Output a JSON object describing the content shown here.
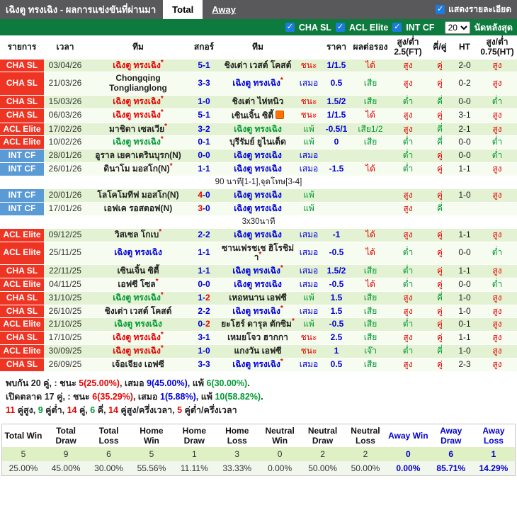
{
  "colors": {
    "red": "#e60000",
    "green": "#009933",
    "blue": "#0000dd",
    "black": "#222",
    "league_red": "#ee3524",
    "league_blue": "#5b9bd5",
    "bar_green": "#0d7a3e",
    "titlebar_gray": "#59595b"
  },
  "titlebar": {
    "title": "เฉิงตู ทรงเฉิง - ผลการแข่งขันที่ผ่านมา",
    "tabs": [
      {
        "label": "Total",
        "active": true
      },
      {
        "label": "Away",
        "active": false
      }
    ],
    "details_checkbox_label": "แสดงรายละเอียด",
    "details_checked": true
  },
  "filterbar": {
    "leagues": [
      "CHA SL",
      "ACL Elite",
      "INT CF"
    ],
    "select_value": "20",
    "last_matches_label": "นัดหลังสุด"
  },
  "table": {
    "columns": [
      "รายการ",
      "เวลา",
      "ทีม",
      "สกอร์",
      "ทีม",
      "",
      "ราคา",
      "ผลต่อรอง",
      "สูง/ต่ำ 2.5(FT)",
      "คี่/คู่",
      "HT",
      "สูง/ต่ำ 0.75(HT)"
    ],
    "rows": [
      {
        "lg": "CHA SL",
        "lgc": "red",
        "d": "03/04/26",
        "t1": "เฉิงตู ทรงเฉิง",
        "t1c": "red",
        "t1star": true,
        "s1": "5",
        "s2": "1",
        "t2": "ชิงเต่า เวสต์ โคสต์",
        "res": "ชนะ",
        "resc": "red",
        "odds": "1/1.5",
        "hcp": "ได้",
        "hcpc": "red",
        "ou": "สูง",
        "ouc": "red",
        "oe": "คู่",
        "oec": "red",
        "ht": "2-0",
        "ouht": "สูง",
        "ouhtc": "red"
      },
      {
        "lg": "CHA SL",
        "lgc": "red",
        "d": "21/03/26",
        "t1": "Chongqing Tonglianglong",
        "s1": "3",
        "s2": "3",
        "t2": "เฉิงตู ทรงเฉิง",
        "t2c": "blue",
        "t2star": true,
        "res": "เสมอ",
        "resc": "blue",
        "odds": "0.5",
        "hcp": "เสีย",
        "hcpc": "green",
        "ou": "สูง",
        "ouc": "red",
        "oe": "คู่",
        "oec": "red",
        "ht": "0-2",
        "ouht": "สูง",
        "ouhtc": "red"
      },
      {
        "lg": "CHA SL",
        "lgc": "red",
        "d": "15/03/26",
        "t1": "เฉิงตู ทรงเฉิง",
        "t1c": "red",
        "t1star": true,
        "s1": "1",
        "s2": "0",
        "t2": "ชิงเต่า ไห่หนิว",
        "res": "ชนะ",
        "resc": "red",
        "odds": "1.5/2",
        "hcp": "เสีย",
        "hcpc": "green",
        "ou": "ต่ำ",
        "ouc": "green",
        "oe": "คี่",
        "oec": "green",
        "ht": "0-0",
        "ouht": "ต่ำ",
        "ouhtc": "green"
      },
      {
        "lg": "CHA SL",
        "lgc": "red",
        "d": "06/03/26",
        "t1": "เฉิงตู ทรงเฉิง",
        "t1c": "red",
        "t1star": true,
        "s1": "5",
        "s2": "1",
        "t2": "เซินเจิ้น ซิตี้",
        "t2badge": true,
        "res": "ชนะ",
        "resc": "red",
        "odds": "1/1.5",
        "hcp": "ได้",
        "hcpc": "red",
        "ou": "สูง",
        "ouc": "red",
        "oe": "คู่",
        "oec": "red",
        "ht": "3-1",
        "ouht": "สูง",
        "ouhtc": "red"
      },
      {
        "lg": "ACL Elite",
        "lgc": "red",
        "d": "17/02/26",
        "t1": "มาชิดา เซลเวีย",
        "t1star": true,
        "s1": "3",
        "s2": "2",
        "t2": "เฉิงตู ทรงเฉิง",
        "t2c": "green",
        "res": "แพ้",
        "resc": "green",
        "odds": "-0.5/1",
        "hcp": "เสีย1/2",
        "hcpc": "green",
        "ou": "สูง",
        "ouc": "red",
        "oe": "คี่",
        "oec": "green",
        "ht": "2-1",
        "ouht": "สูง",
        "ouhtc": "red"
      },
      {
        "lg": "ACL Elite",
        "lgc": "red",
        "d": "10/02/26",
        "t1": "เฉิงตู ทรงเฉิง",
        "t1c": "green",
        "t1star": true,
        "s1": "0",
        "s2": "1",
        "t2": "บุรีรัมย์ ยูไนเต็ด",
        "res": "แพ้",
        "resc": "green",
        "odds": "0",
        "hcp": "เสีย",
        "hcpc": "green",
        "ou": "ต่ำ",
        "ouc": "green",
        "oe": "คี่",
        "oec": "green",
        "ht": "0-0",
        "ouht": "ต่ำ",
        "ouhtc": "green"
      },
      {
        "lg": "INT CF",
        "lgc": "blue",
        "d": "28/01/26",
        "t1": "อูราล เยคาเตรินบุรก(N)",
        "s1": "0",
        "s2": "0",
        "t2": "เฉิงตู ทรงเฉิง",
        "t2c": "blue",
        "res": "เสมอ",
        "resc": "blue",
        "odds": "",
        "hcp": "",
        "ou": "ต่ำ",
        "ouc": "green",
        "oe": "คู่",
        "oec": "red",
        "ht": "0-0",
        "ouht": "ต่ำ",
        "ouhtc": "green"
      },
      {
        "lg": "INT CF",
        "lgc": "blue",
        "d": "26/01/26",
        "t1": "ดินาโม มอสโก(N)",
        "t1star": true,
        "s1": "1",
        "s2": "1",
        "t2": "เฉิงตู ทรงเฉิง",
        "t2c": "blue",
        "res": "เสมอ",
        "resc": "blue",
        "odds": "-1.5",
        "hcp": "ได้",
        "hcpc": "red",
        "ou": "ต่ำ",
        "ouc": "green",
        "oe": "คู่",
        "oec": "red",
        "ht": "1-1",
        "ouht": "สูง",
        "ouhtc": "red"
      },
      {
        "note": "90 นาที[1-1],จุดโทษ[3-4]"
      },
      {
        "lg": "INT CF",
        "lgc": "blue",
        "d": "20/01/26",
        "t1": "โลโคโมทีฟ มอสโก(N)",
        "s1": "4",
        "s1c": "red",
        "s2": "0",
        "t2": "เฉิงตู ทรงเฉิง",
        "t2c": "blue",
        "res": "แพ้",
        "resc": "green",
        "odds": "",
        "hcp": "",
        "ou": "สูง",
        "ouc": "red",
        "oe": "คู่",
        "oec": "red",
        "ht": "1-0",
        "ouht": "สูง",
        "ouhtc": "red"
      },
      {
        "lg": "INT CF",
        "lgc": "blue",
        "d": "17/01/26",
        "t1": "เอฟเค รอสตอฟ(N)",
        "s1": "3",
        "s1c": "red",
        "s2": "0",
        "t2": "เฉิงตู ทรงเฉิง",
        "t2c": "blue",
        "res": "แพ้",
        "resc": "green",
        "odds": "",
        "hcp": "",
        "ou": "สูง",
        "ouc": "red",
        "oe": "คี่",
        "oec": "green",
        "ht": "",
        "ouht": ""
      },
      {
        "note": "3x30นาที"
      },
      {
        "lg": "ACL Elite",
        "lgc": "red",
        "d": "09/12/25",
        "t1": "วิสเซล โกเบ",
        "t1star": true,
        "s1": "2",
        "s2": "2",
        "t2": "เฉิงตู ทรงเฉิง",
        "t2c": "blue",
        "res": "เสมอ",
        "resc": "blue",
        "odds": "-1",
        "hcp": "ได้",
        "hcpc": "red",
        "ou": "สูง",
        "ouc": "red",
        "oe": "คู่",
        "oec": "red",
        "ht": "1-1",
        "ouht": "สูง",
        "ouhtc": "red"
      },
      {
        "lg": "ACL Elite",
        "lgc": "red",
        "d": "25/11/25",
        "t1": "เฉิงตู ทรงเฉิง",
        "t1c": "blue",
        "s1": "1",
        "s2": "1",
        "t2": "ซานเฟรชเช ฮิโรชิม่า",
        "t2star": true,
        "res": "เสมอ",
        "resc": "blue",
        "odds": "-0.5",
        "hcp": "ได้",
        "hcpc": "red",
        "ou": "ต่ำ",
        "ouc": "green",
        "oe": "คู่",
        "oec": "red",
        "ht": "0-0",
        "ouht": "ต่ำ",
        "ouhtc": "green"
      },
      {
        "lg": "CHA SL",
        "lgc": "red",
        "d": "22/11/25",
        "t1": "เซินเจิ้น ซิตี้",
        "s1": "1",
        "s2": "1",
        "t2": "เฉิงตู ทรงเฉิง",
        "t2c": "blue",
        "t2star": true,
        "res": "เสมอ",
        "resc": "blue",
        "odds": "1.5/2",
        "hcp": "เสีย",
        "hcpc": "green",
        "ou": "ต่ำ",
        "ouc": "green",
        "oe": "คู่",
        "oec": "red",
        "ht": "1-1",
        "ouht": "สูง",
        "ouhtc": "red"
      },
      {
        "lg": "ACL Elite",
        "lgc": "red",
        "d": "04/11/25",
        "t1": "เอฟซี โซล",
        "t1star": true,
        "s1": "0",
        "s2": "0",
        "t2": "เฉิงตู ทรงเฉิง",
        "t2c": "blue",
        "res": "เสมอ",
        "resc": "blue",
        "odds": "-0.5",
        "hcp": "ได้",
        "hcpc": "red",
        "ou": "ต่ำ",
        "ouc": "green",
        "oe": "คู่",
        "oec": "red",
        "ht": "0-0",
        "ouht": "ต่ำ",
        "ouhtc": "green"
      },
      {
        "lg": "CHA SL",
        "lgc": "red",
        "d": "31/10/25",
        "t1": "เฉิงตู ทรงเฉิง",
        "t1c": "green",
        "t1star": true,
        "s1": "1",
        "s2": "2",
        "s2c": "red",
        "t2": "เหอหนาน เอฟซี",
        "res": "แพ้",
        "resc": "green",
        "odds": "1.5",
        "hcp": "เสีย",
        "hcpc": "green",
        "ou": "สูง",
        "ouc": "red",
        "oe": "คี่",
        "oec": "green",
        "ht": "1-0",
        "ouht": "สูง",
        "ouhtc": "red"
      },
      {
        "lg": "CHA SL",
        "lgc": "red",
        "d": "26/10/25",
        "t1": "ชิงเต่า เวสต์ โคสต์",
        "s1": "2",
        "s2": "2",
        "t2": "เฉิงตู ทรงเฉิง",
        "t2c": "blue",
        "t2star": true,
        "res": "เสมอ",
        "resc": "blue",
        "odds": "1.5",
        "hcp": "เสีย",
        "hcpc": "green",
        "ou": "สูง",
        "ouc": "red",
        "oe": "คู่",
        "oec": "red",
        "ht": "1-0",
        "ouht": "สูง",
        "ouhtc": "red"
      },
      {
        "lg": "ACL Elite",
        "lgc": "red",
        "d": "21/10/25",
        "t1": "เฉิงตู ทรงเฉิง",
        "t1c": "green",
        "s1": "0",
        "s2": "2",
        "s2c": "red",
        "t2": "ยะโฮร์ ดารุล ตักซิม",
        "t2star": true,
        "res": "แพ้",
        "resc": "green",
        "odds": "-0.5",
        "hcp": "เสีย",
        "hcpc": "green",
        "ou": "ต่ำ",
        "ouc": "green",
        "oe": "คู่",
        "oec": "red",
        "ht": "0-1",
        "ouht": "สูง",
        "ouhtc": "red"
      },
      {
        "lg": "CHA SL",
        "lgc": "red",
        "d": "17/10/25",
        "t1": "เฉิงตู ทรงเฉิง",
        "t1c": "red",
        "t1star": true,
        "s1": "3",
        "s2": "1",
        "t2": "เหมยโจว ฮากกา",
        "res": "ชนะ",
        "resc": "red",
        "odds": "2.5",
        "hcp": "เสีย",
        "hcpc": "green",
        "ou": "สูง",
        "ouc": "red",
        "oe": "คู่",
        "oec": "red",
        "ht": "1-1",
        "ouht": "สูง",
        "ouhtc": "red"
      },
      {
        "lg": "ACL Elite",
        "lgc": "red",
        "d": "30/09/25",
        "t1": "เฉิงตู ทรงเฉิง",
        "t1c": "red",
        "t1star": true,
        "s1": "1",
        "s2": "0",
        "t2": "แกงวัน เอฟซี",
        "res": "ชนะ",
        "resc": "red",
        "odds": "1",
        "hcp": "เจ๊า",
        "hcpc": "green",
        "ou": "ต่ำ",
        "ouc": "green",
        "oe": "คี่",
        "oec": "green",
        "ht": "1-0",
        "ouht": "สูง",
        "ouhtc": "red"
      },
      {
        "lg": "CHA SL",
        "lgc": "red",
        "d": "26/09/25",
        "t1": "เจ้อเจียง เอฟซี",
        "s1": "3",
        "s2": "3",
        "t2": "เฉิงตู ทรงเฉิง",
        "t2c": "blue",
        "t2star": true,
        "res": "เสมอ",
        "resc": "blue",
        "odds": "0.5",
        "hcp": "เสีย",
        "hcpc": "green",
        "ou": "สูง",
        "ouc": "red",
        "oe": "คู่",
        "oec": "red",
        "ht": "2-3",
        "ouht": "สูง",
        "ouhtc": "red"
      }
    ]
  },
  "summary": {
    "lines": [
      [
        {
          "t": "พบกัน 20 คู่, : ชนะ "
        },
        {
          "t": "5(25.00%)",
          "c": "red"
        },
        {
          "t": ", เสมอ "
        },
        {
          "t": "9(45.00%)",
          "c": "blue"
        },
        {
          "t": ", แพ้ "
        },
        {
          "t": "6(30.00%)",
          "c": "green"
        },
        {
          "t": "."
        }
      ],
      [
        {
          "t": "เปิดตลาด 17 คู่, : ชนะ "
        },
        {
          "t": "6(35.29%)",
          "c": "red"
        },
        {
          "t": ", เสมอ "
        },
        {
          "t": "1(5.88%)",
          "c": "blue"
        },
        {
          "t": ", แพ้ "
        },
        {
          "t": "10(58.82%)",
          "c": "green"
        },
        {
          "t": "."
        }
      ],
      [
        {
          "t": "11",
          "c": "red"
        },
        {
          "t": " คู่สูง, "
        },
        {
          "t": "9",
          "c": "green"
        },
        {
          "t": " คู่ต่ำ, "
        },
        {
          "t": "14",
          "c": "red"
        },
        {
          "t": " คู่, "
        },
        {
          "t": "6",
          "c": "green"
        },
        {
          "t": " คี่, "
        },
        {
          "t": "14",
          "c": "red"
        },
        {
          "t": " คู่สูง/ครึ่งเวลา, "
        },
        {
          "t": "5",
          "c": "red"
        },
        {
          "t": " คู่ต่ำ/ครึ่งเวลา"
        }
      ]
    ]
  },
  "stats": {
    "headers": [
      "Total Win",
      "Total Draw",
      "Total Loss",
      "Home Win",
      "Home Draw",
      "Home Loss",
      "Neutral Win",
      "Neutral Draw",
      "Neutral Loss",
      "Away Win",
      "Away Draw",
      "Away Loss"
    ],
    "values": [
      "5",
      "9",
      "6",
      "5",
      "1",
      "3",
      "0",
      "2",
      "2",
      "0",
      "6",
      "1"
    ],
    "percents": [
      "25.00%",
      "45.00%",
      "30.00%",
      "55.56%",
      "11.11%",
      "33.33%",
      "0.00%",
      "50.00%",
      "50.00%",
      "0.00%",
      "85.71%",
      "14.29%"
    ],
    "away_columns": [
      9,
      10,
      11
    ]
  }
}
